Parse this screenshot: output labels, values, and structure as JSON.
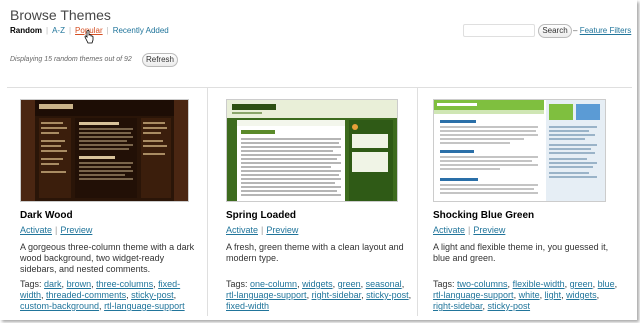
{
  "page": {
    "title": "Browse Themes",
    "filters": {
      "current": "Random",
      "links": [
        "A-Z",
        "Popular",
        "Recently Added"
      ]
    },
    "search": {
      "button": "Search",
      "feature_filters": "Feature Filters",
      "dash": "–"
    },
    "display_text": "Displaying 15 random themes out of 92",
    "refresh_label": "Refresh",
    "link_color": "#21759b",
    "hover_link_color": "#d54e21"
  },
  "themes": [
    {
      "name": "Dark Wood",
      "activate": "Activate",
      "preview": "Preview",
      "description": "A gorgeous three-column theme with a dark wood background, two widget-ready sidebars, and nested comments.",
      "tags_label": "Tags:",
      "tags": [
        "dark",
        "brown",
        "three-columns",
        "fixed-width",
        "threaded-comments",
        "sticky-post",
        "custom-background",
        "rtl-language-support"
      ]
    },
    {
      "name": "Spring Loaded",
      "activate": "Activate",
      "preview": "Preview",
      "description": "A fresh, green theme with a clean layout and modern type.",
      "tags_label": "Tags:",
      "tags": [
        "one-column",
        "widgets",
        "green",
        "seasonal",
        "rtl-language-support",
        "right-sidebar",
        "sticky-post",
        "fixed-width"
      ]
    },
    {
      "name": "Shocking Blue Green",
      "activate": "Activate",
      "preview": "Preview",
      "description": "A light and flexible theme in, you guessed it, blue and green.",
      "tags_label": "Tags:",
      "tags": [
        "two-columns",
        "flexible-width",
        "green",
        "blue",
        "rtl-language-support",
        "white",
        "light",
        "widgets",
        "right-sidebar",
        "sticky-post"
      ]
    }
  ]
}
